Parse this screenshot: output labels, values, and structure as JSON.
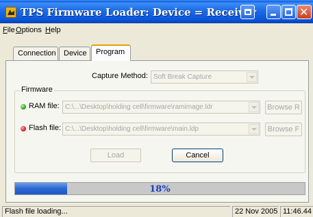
{
  "window": {
    "title": "TPS Firmware Loader:  Device = Receiver"
  },
  "menu": [
    {
      "label": "File",
      "mnemonic": "F",
      "rest": "ile"
    },
    {
      "label": "Options",
      "mnemonic": "O",
      "rest": "ptions"
    },
    {
      "label": "Help",
      "mnemonic": "H",
      "rest": "elp"
    }
  ],
  "tabs": [
    {
      "label": "Connection"
    },
    {
      "label": "Device"
    },
    {
      "label": "Program",
      "active": true
    }
  ],
  "capture": {
    "label": "Capture Method:",
    "value": "Soft Break Capture"
  },
  "firmware": {
    "group_title": "Firmware",
    "ram": {
      "label": "RAM file:",
      "path": "C:\\...\\Desktop\\holding cell\\firmware\\ramimage.ldr",
      "browse_label": "Browse R",
      "status_color": "#1a9a10"
    },
    "flash": {
      "label": "Flash file:",
      "path": "C:\\...\\Desktop\\holding cell\\firmware\\main.ldp",
      "browse_label": "Browse F",
      "status_color": "#d01010"
    },
    "load_label": "Load",
    "cancel_label": "Cancel"
  },
  "progress": {
    "percent": 18,
    "text": "18%"
  },
  "status": {
    "message": "Flash file loading...",
    "date": "22 Nov 2005",
    "time": "11:46.44"
  },
  "icons": {
    "app": "firmware-loader-app-icon",
    "status_ok": "green-status-dot",
    "status_active": "red-status-dot"
  }
}
